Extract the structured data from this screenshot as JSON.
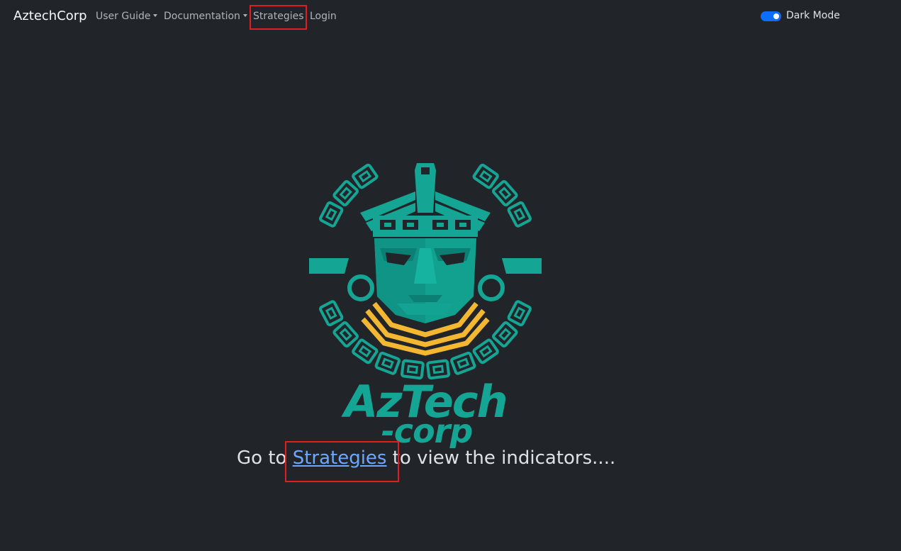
{
  "navbar": {
    "brand": "AztechCorp",
    "items": [
      {
        "label": "User Guide",
        "dropdown": true
      },
      {
        "label": "Documentation",
        "dropdown": true
      },
      {
        "label": "Strategies",
        "dropdown": false
      },
      {
        "label": "Login",
        "dropdown": false
      }
    ],
    "dark_mode": {
      "label": "Dark Mode",
      "enabled": true
    }
  },
  "logo": {
    "wordmark_line1": "AzTech",
    "wordmark_line2": "-corp",
    "icon": "aztec-mask-logo"
  },
  "main": {
    "text_before": "Go to ",
    "link": "Strategies",
    "text_after": " to view the indicators...."
  },
  "colors": {
    "background": "#212529",
    "teal": "#14a594",
    "gold": "#f4b731",
    "link": "#6ea8fe",
    "toggle": "#0d6efd",
    "highlight": "#e11d1d"
  }
}
